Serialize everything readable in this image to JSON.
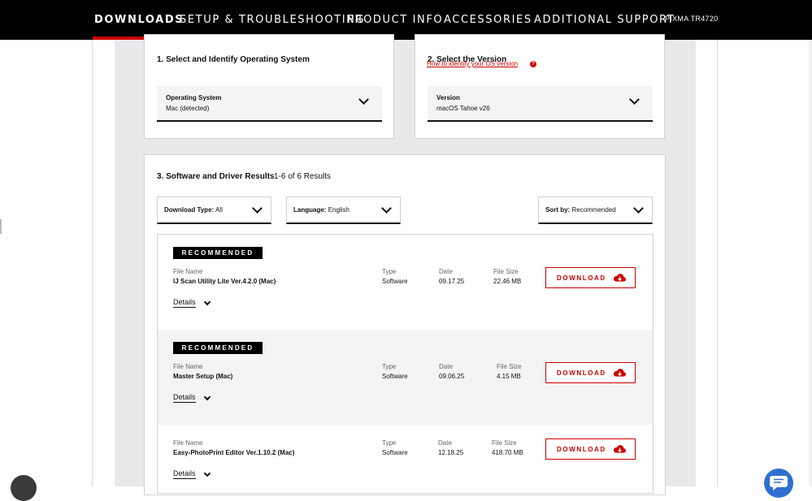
{
  "nav": {
    "items": [
      {
        "label": "DOWNLOADS",
        "active": true
      },
      {
        "label": "SETUP & TROUBLESHOOTING"
      },
      {
        "label": "PRODUCT INFO"
      },
      {
        "label": "ACCESSORIES"
      },
      {
        "label": "ADDITIONAL SUPPORT"
      }
    ],
    "model": "PIXMA TR4720"
  },
  "step1": {
    "title": "1. Select and Identify Operating System",
    "select_label": "Operating System",
    "select_value": "Mac (detected)"
  },
  "step2": {
    "title": "2. Select the Version",
    "link": "How to identify your OS version",
    "help_icon_text": "?",
    "select_label": "Version",
    "select_value": "macOS Tahoe v26"
  },
  "step3": {
    "title": "3. Software and Driver Results",
    "count": "1-6  of  6 Results",
    "filters": {
      "download_type_label": "Download Type:",
      "download_type_value": "All",
      "language_label": "Language:",
      "language_value": "English",
      "sort_label": "Sort by:",
      "sort_value": "Recommended"
    }
  },
  "columns": {
    "file_name": "File Name",
    "type": "Type",
    "date": "Date",
    "file_size": "File Size"
  },
  "badge": "RECOMMENDED",
  "download_label": "DOWNLOAD",
  "details_label": "Details",
  "results": [
    {
      "name": "IJ Scan Utility Lite Ver.4.2.0 (Mac)",
      "type": "Software",
      "date": "09.17.25",
      "size": "22.46 MB",
      "recommended": true
    },
    {
      "name": "Master Setup (Mac)",
      "type": "Software",
      "date": "09.06.25",
      "size": "4.15 MB",
      "recommended": true
    },
    {
      "name": "Easy-PhotoPrint Editor Ver.1.10.2 (Mac)",
      "type": "Software",
      "date": "12.18.25",
      "size": "418.70 MB",
      "recommended": false
    }
  ],
  "colors": {
    "accent": "#cc0000",
    "nav_bg": "#000000",
    "band_bg": "#e9e9ec",
    "row_alt_bg": "#f4f4f4",
    "chat_button": "#2f6fd1"
  }
}
